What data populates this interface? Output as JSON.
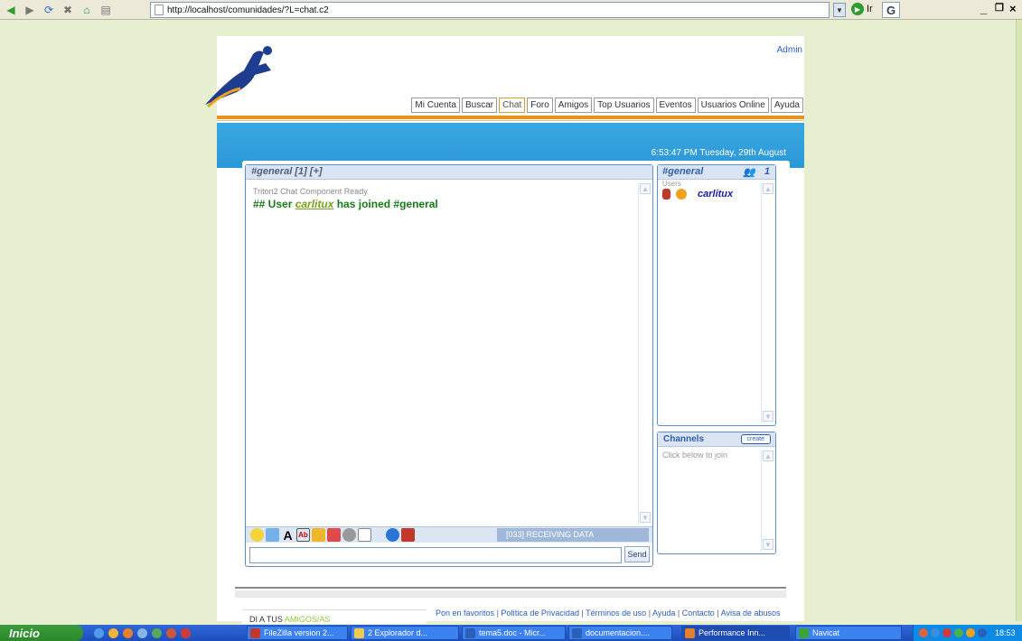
{
  "browser": {
    "url": "http://localhost/comunidades/?L=chat.c2",
    "go_label": "Ir",
    "google_label": "G"
  },
  "site": {
    "admin_link": "Admin",
    "nav_tabs": [
      "Mi Cuenta",
      "Buscar",
      "Chat",
      "Foro",
      "Amigos",
      "Top Usuarios",
      "Eventos",
      "Usuarios Online",
      "Ayuda"
    ],
    "active_tab": "Chat",
    "datetime": "6:53:47 PM Tuesday, 29th August"
  },
  "chat": {
    "tab_title": "#general [1] [+]",
    "system_message": "Triton2 Chat Component Ready",
    "join_prefix": "## User ",
    "join_user": "carlitux",
    "join_suffix": " has joined #general",
    "status": "[033] RECEIVING DATA",
    "send_label": "Send",
    "input_value": ""
  },
  "users": {
    "channel": "#general",
    "count": "1",
    "label": "Users",
    "list": [
      {
        "name": "carlitux"
      }
    ]
  },
  "channels": {
    "title": "Channels",
    "create_label": "create",
    "hint": "Click below to join"
  },
  "footer": {
    "links": [
      "Pon en favoritos",
      "Política de Privacidad",
      "Términos de uso",
      "Ayuda",
      "Contacto",
      "Avisa de abusos"
    ],
    "invite_prefix": "DI A TUS ",
    "invite_highlight": "AMIGOS/AS"
  },
  "taskbar": {
    "start_label": "Inicio",
    "tasks": [
      "FileZilla version 2...",
      "2 Explorador d...",
      "tema5.doc - Micr...",
      "documentacion....",
      "Performance Inn...",
      "Navicat"
    ],
    "clock": "18:53"
  },
  "colors": {
    "accent_orange": "#e8931f",
    "banner_blue": "#2b98d7",
    "chat_green": "#177c17",
    "user_link": "#1c1ca8"
  }
}
